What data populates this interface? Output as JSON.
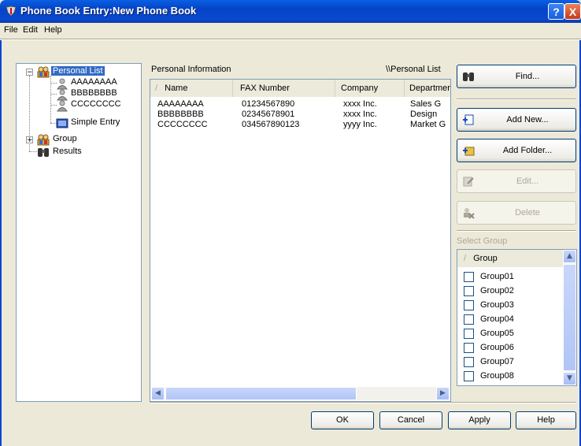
{
  "window": {
    "title": "Phone Book Entry:New Phone Book",
    "help_label": "?",
    "close_label": "X"
  },
  "menu": [
    "File",
    "Edit",
    "Help"
  ],
  "tree": {
    "items": [
      {
        "label": "Personal List",
        "icon": "people-group-icon",
        "selected": true
      },
      {
        "label": "AAAAAAAA",
        "icon": "person-icon"
      },
      {
        "label": "BBBBBBBB",
        "icon": "person-icon"
      },
      {
        "label": "CCCCCCCC",
        "icon": "person-icon"
      },
      {
        "label": "Simple Entry",
        "icon": "folder-icon"
      },
      {
        "label": "Group",
        "icon": "people-group-icon"
      },
      {
        "label": "Results",
        "icon": "binoculars-icon"
      }
    ],
    "expander_minus": "−",
    "expander_plus": "+"
  },
  "personal_info": {
    "label": "Personal Information",
    "path": "\\\\Personal List",
    "sort_glyph": "/",
    "columns": [
      "Name",
      "FAX Number",
      "Company",
      "Departmer"
    ],
    "rows": [
      [
        "AAAAAAAA",
        "01234567890",
        "xxxx Inc.",
        "Sales G"
      ],
      [
        "BBBBBBBB",
        "02345678901",
        "xxxx Inc.",
        "Design"
      ],
      [
        "CCCCCCCC",
        "034567890123",
        "yyyy Inc.",
        "Market G"
      ]
    ],
    "scroll_left": "◀",
    "scroll_right": "▶"
  },
  "side_buttons": {
    "find": "Find...",
    "add_new": "Add New...",
    "add_folder": "Add Folder...",
    "edit": "Edit...",
    "delete": "Delete"
  },
  "select_group": {
    "label": "Select Group",
    "header": "Group",
    "groups": [
      "Group01",
      "Group02",
      "Group03",
      "Group04",
      "Group05",
      "Group06",
      "Group07",
      "Group08"
    ],
    "scroll_up": "▲",
    "scroll_down": "▼"
  },
  "dialog_buttons": {
    "ok": "OK",
    "cancel": "Cancel",
    "apply": "Apply",
    "help": "Help"
  },
  "colors": {
    "titlebar": "#0a49d0",
    "selection": "#316ac5",
    "dialog_bg": "#ece9d8"
  }
}
